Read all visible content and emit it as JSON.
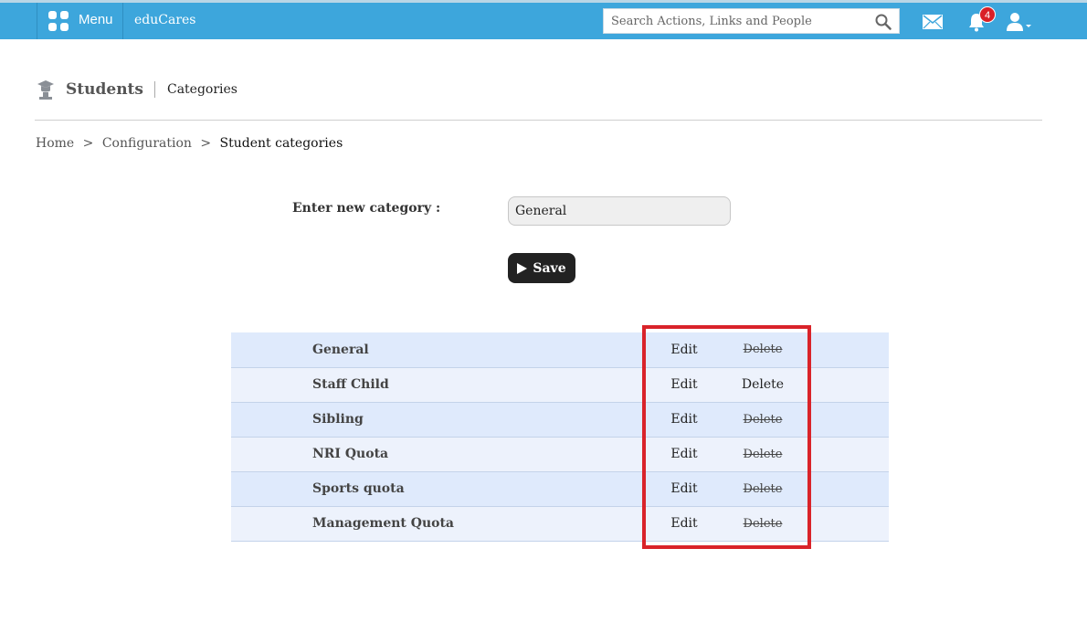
{
  "topbar": {
    "menu_label": "Menu",
    "brand": "eduCares",
    "search_placeholder": "Search Actions, Links and People",
    "notification_count": "4",
    "accent_color": "#3da6dc"
  },
  "page": {
    "title": "Students",
    "subtitle": "Categories"
  },
  "breadcrumb": {
    "items": [
      "Home",
      "Configuration",
      "Student categories"
    ],
    "separator": ">"
  },
  "form": {
    "label": "Enter new category :",
    "value": "General",
    "save_label": "Save"
  },
  "categories": [
    {
      "name": "General",
      "edit": "Edit",
      "delete": "Delete",
      "delete_disabled": true
    },
    {
      "name": "Staff Child",
      "edit": "Edit",
      "delete": "Delete",
      "delete_disabled": false
    },
    {
      "name": "Sibling",
      "edit": "Edit",
      "delete": "Delete",
      "delete_disabled": true
    },
    {
      "name": "NRI Quota",
      "edit": "Edit",
      "delete": "Delete",
      "delete_disabled": true
    },
    {
      "name": "Sports quota",
      "edit": "Edit",
      "delete": "Delete",
      "delete_disabled": true
    },
    {
      "name": "Management Quota",
      "edit": "Edit",
      "delete": "Delete",
      "delete_disabled": true
    }
  ],
  "icons": {
    "menu": "grid-icon",
    "search": "search-icon",
    "mail": "mail-icon",
    "bell": "bell-icon",
    "user": "user-icon",
    "students": "students-icon"
  },
  "colors": {
    "highlight": "#d9232a",
    "badge": "#d92027"
  }
}
